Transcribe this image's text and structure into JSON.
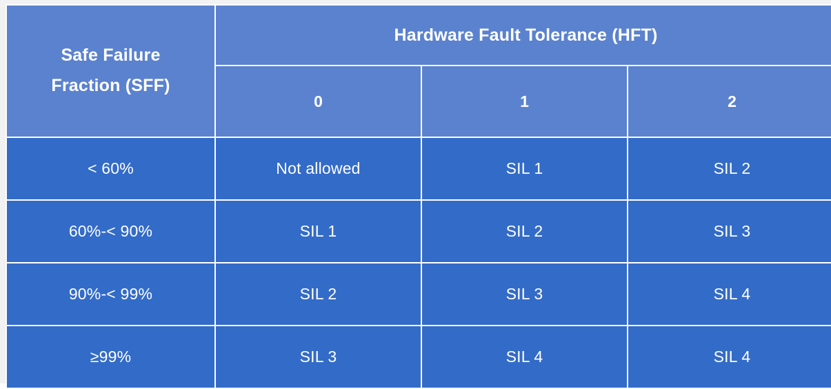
{
  "table": {
    "row_header_title": "Safe Failure\nFraction  (SFF)",
    "row_header_line1": "Safe Failure",
    "row_header_line2": "Fraction  (SFF)",
    "col_group_title": "Hardware Fault Tolerance (HFT)",
    "column_headers": [
      "0",
      "1",
      "2"
    ],
    "rows": [
      {
        "sff": "< 60%",
        "values": [
          "Not allowed",
          "SIL 1",
          "SIL 2"
        ]
      },
      {
        "sff": "60%-< 90%",
        "values": [
          "SIL 1",
          "SIL 2",
          "SIL 3"
        ]
      },
      {
        "sff": "90%-< 99%",
        "values": [
          "SIL 2",
          "SIL 3",
          "SIL 4"
        ]
      },
      {
        "sff": "≥99%",
        "values": [
          "SIL 3",
          "SIL 4",
          "SIL 4"
        ]
      }
    ]
  },
  "colors": {
    "header_blue": "#5B82CE",
    "body_blue": "#336BC8",
    "gridline": "#FFFFFF",
    "text": "#FFFFFF",
    "page_background": "#F2F2F2"
  }
}
